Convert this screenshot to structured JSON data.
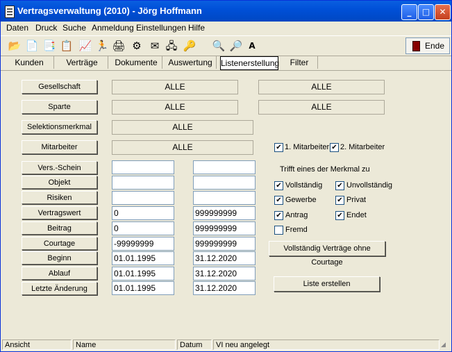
{
  "window": {
    "title": "Vertragsverwaltung (2010) - Jörg Hoffmann"
  },
  "menu": [
    "Daten",
    "Druck",
    "Suche",
    "Anmeldung",
    "Einstellungen",
    "Hilfe"
  ],
  "toolbar": {
    "ende_label": "Ende"
  },
  "tabs": [
    "Kunden",
    "Verträge",
    "Dokumente",
    "Auswertung",
    "Listenerstellung",
    "Filter"
  ],
  "filters": {
    "gesellschaft": {
      "label": "Gesellschaft",
      "value1": "ALLE",
      "value2": "ALLE"
    },
    "sparte": {
      "label": "Sparte",
      "value1": "ALLE",
      "value2": "ALLE"
    },
    "selektionsmerkmal": {
      "label": "Selektionsmerkmal",
      "value": "ALLE"
    },
    "mitarbeiter": {
      "label": "Mitarbeiter",
      "value": "ALLE"
    }
  },
  "ranges": [
    {
      "label": "Vers.-Schein",
      "from": "",
      "to": ""
    },
    {
      "label": "Objekt",
      "from": "",
      "to": ""
    },
    {
      "label": "Risiken",
      "from": "",
      "to": ""
    },
    {
      "label": "Vertragswert",
      "from": "0",
      "to": "999999999"
    },
    {
      "label": "Beitrag",
      "from": "0",
      "to": "999999999"
    },
    {
      "label": "Courtage",
      "from": "-99999999",
      "to": "999999999"
    },
    {
      "label": "Beginn",
      "from": "01.01.1995",
      "to": "31.12.2020"
    },
    {
      "label": "Ablauf",
      "from": "01.01.1995",
      "to": "31.12.2020"
    },
    {
      "label": "Letzte Änderung",
      "from": "01.01.1995",
      "to": "31.12.2020"
    }
  ],
  "mitarbeiter_checks": {
    "first": "1. Mitarbeiter",
    "second": "2. Mitarbeiter"
  },
  "merkmal": {
    "heading": "Trifft eines der Merkmal zu",
    "items": [
      {
        "label": "Vollständig",
        "checked": true
      },
      {
        "label": "Unvollständig",
        "checked": true
      },
      {
        "label": "Gewerbe",
        "checked": true
      },
      {
        "label": "Privat",
        "checked": true
      },
      {
        "label": "Antrag",
        "checked": true
      },
      {
        "label": "Endet",
        "checked": true
      },
      {
        "label": "Fremd",
        "checked": false
      }
    ]
  },
  "buttons": {
    "vollstaendig": "Vollständig Verträge ohne Courtage",
    "liste": "Liste erstellen"
  },
  "statusbar": {
    "ansicht": "Ansicht",
    "name": "Name",
    "datum": "Datum",
    "message": "VI neu angelegt"
  }
}
